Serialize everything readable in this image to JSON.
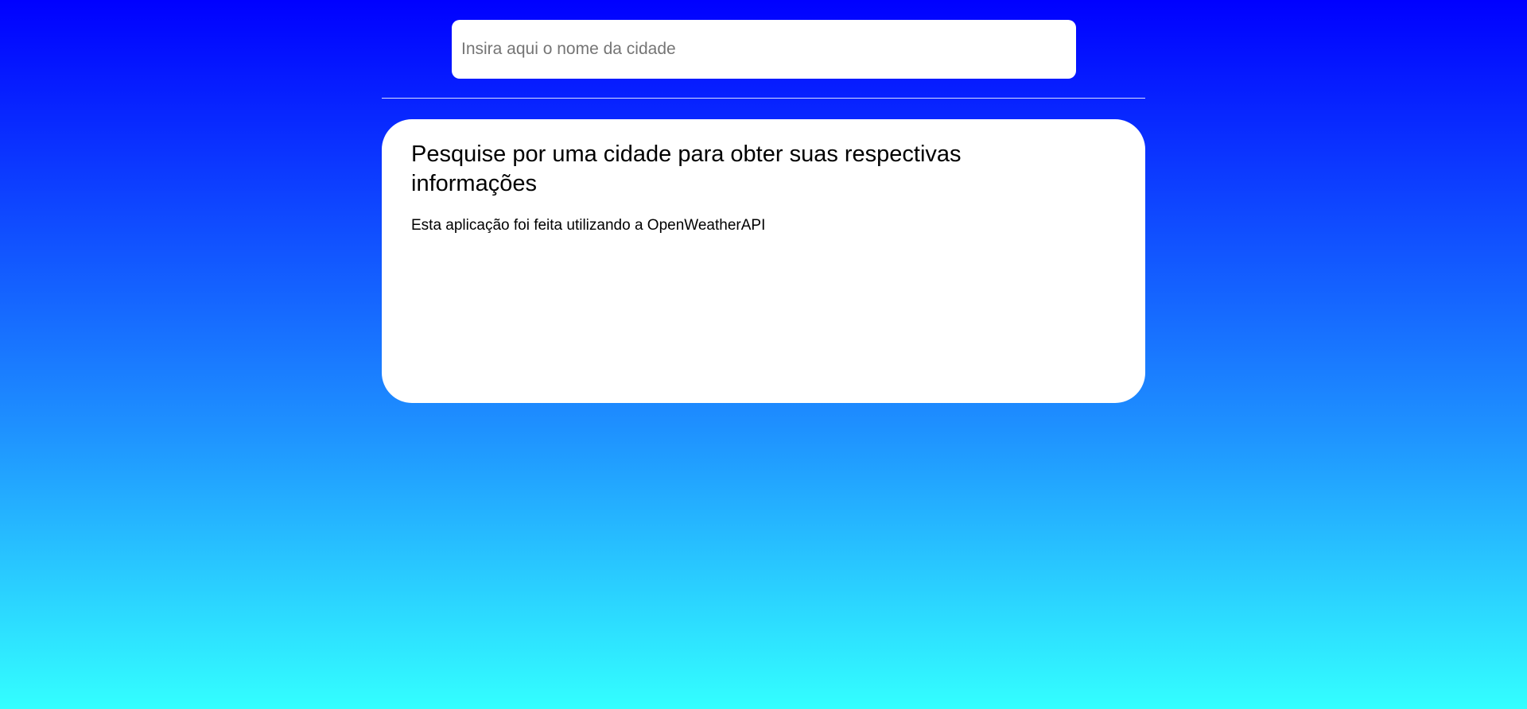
{
  "search": {
    "placeholder": "Insira aqui o nome da cidade",
    "value": ""
  },
  "info_card": {
    "title": "Pesquise por uma cidade para obter suas respectivas informações",
    "subtitle": "Esta aplicação foi feita utilizando a OpenWeatherAPI"
  },
  "colors": {
    "gradient_top": "#0000ff",
    "gradient_mid": "#1e90ff",
    "gradient_bottom": "#33ffff",
    "card_background": "#ffffff",
    "divider": "#ffffff"
  }
}
